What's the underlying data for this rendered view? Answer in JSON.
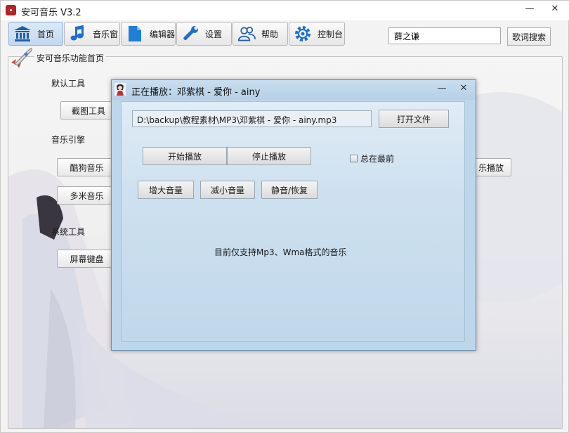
{
  "window": {
    "title": "安可音乐 V3.2",
    "minimize": "—",
    "close": "✕"
  },
  "toolbar": {
    "items": [
      {
        "label": "首页",
        "icon": "bank-icon"
      },
      {
        "label": "音乐窗",
        "icon": "music-note-icon"
      },
      {
        "label": "编辑器",
        "icon": "document-icon"
      },
      {
        "label": "设置",
        "icon": "wrench-icon"
      },
      {
        "label": "帮助",
        "icon": "users-icon"
      },
      {
        "label": "控制台",
        "icon": "gear-icon"
      }
    ],
    "search_value": "薛之谦",
    "lyrics_search_label": "歌词搜索"
  },
  "home": {
    "group_title": "安可音乐功能首页",
    "default_tools": {
      "label": "默认工具",
      "screenshot_button": "截图工具"
    },
    "music_engine": {
      "label": "音乐引擎",
      "kugou_button": "酷狗音乐",
      "duomi_button": "多米音乐",
      "partial_button": "乐播放"
    },
    "system_tools": {
      "label": "系统工具",
      "keyboard_button": "屏幕键盘"
    }
  },
  "player": {
    "title": "正在播放：邓紫棋 - 爱你 - ainy",
    "minimize": "—",
    "close": "✕",
    "file_path": "D:\\backup\\教程素材\\MP3\\邓紫棋  -  爱你  -  ainy.mp3",
    "open_file_label": "打开文件",
    "start_label": "开始播放",
    "stop_label": "停止播放",
    "always_on_top_label": "总在最前",
    "always_on_top_checked": false,
    "volume_up_label": "增大音量",
    "volume_down_label": "减小音量",
    "mute_label": "静音/恢复",
    "support_text": "目前仅支持Mp3、Wma格式的音乐"
  }
}
